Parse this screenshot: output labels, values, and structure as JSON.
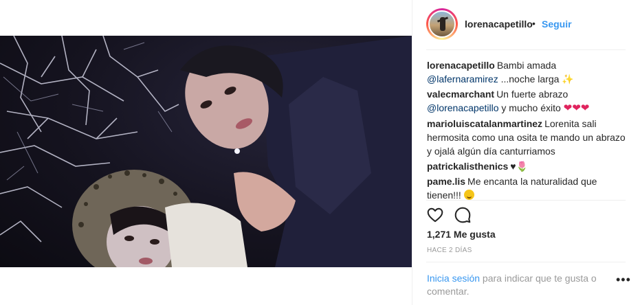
{
  "header": {
    "username": "lorenacapetillo",
    "dot": "•",
    "follow_label": "Seguir"
  },
  "comments": [
    {
      "user": "lorenacapetillo",
      "text1": "Bambi amada",
      "mention": "@lafernaramirez",
      "text2": " ...noche larga "
    },
    {
      "user": "valecmarchant",
      "text1": "Un fuerte abrazo",
      "mention": "@lorenacapetillo",
      "text2": " y mucho éxito "
    },
    {
      "user": "marioluiscatalanmartinez",
      "text1": "Lorenita sali hermosita como una osita te mando un abrazo y ojalá algún día canturriamos"
    },
    {
      "user": "patrickalisthenics",
      "text1": "♥"
    },
    {
      "user": "pame.lis",
      "text1": "Me encanta la naturalidad que tienen!!! "
    }
  ],
  "emoji": {
    "sparkles": "✨",
    "hearts": "❤❤❤",
    "tulip": "🌷"
  },
  "likes": "1,271 Me gusta",
  "time_ago": "HACE 2 DÍAS",
  "login": {
    "link_label": "Inicia sesión",
    "rest": " para indicar que te gusta o comentar."
  },
  "more_label": "•••",
  "icons": [
    "heart-icon",
    "comment-icon",
    "more-options-icon"
  ]
}
